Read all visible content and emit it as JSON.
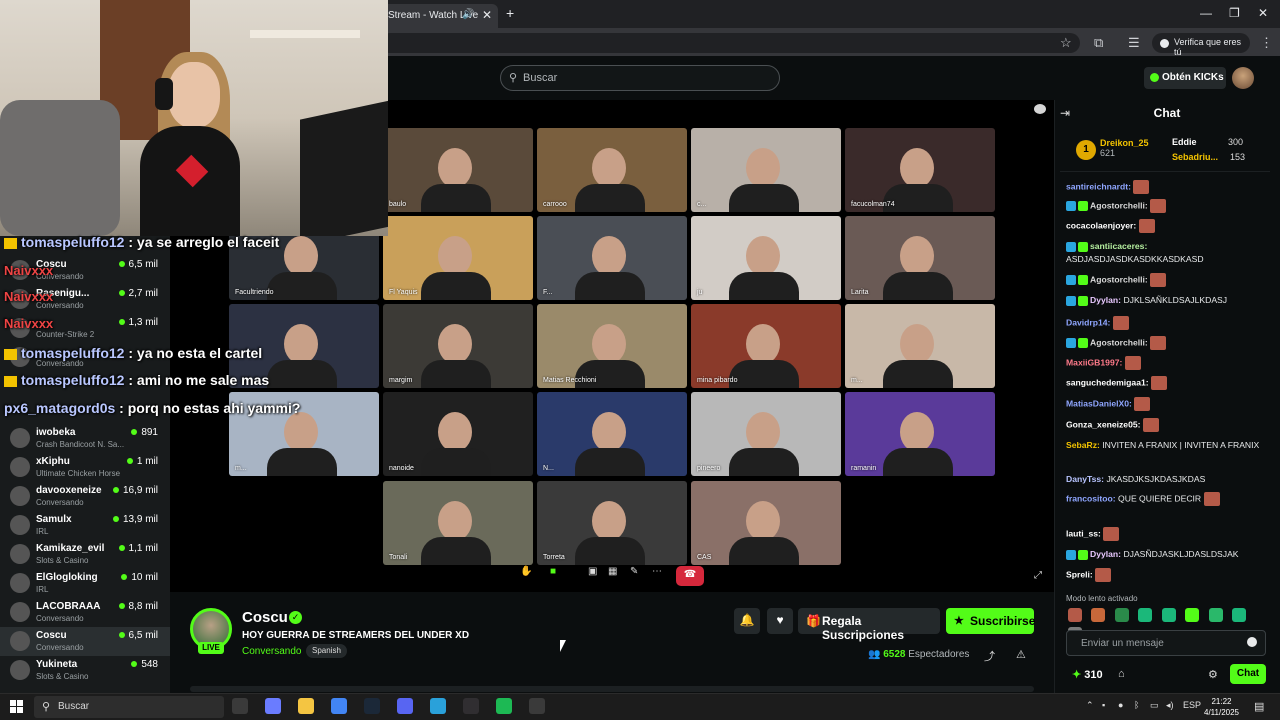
{
  "browser": {
    "tab_title": "Stream - Watch Live",
    "verify_label": "Verifica que eres tú"
  },
  "header": {
    "search_placeholder": "Buscar",
    "kicks_label": "Obtén KICKs"
  },
  "overlay_chat": [
    {
      "user": "tomaspeluffo12",
      "text": ": ya se arreglo el faceit"
    },
    {
      "user": "tomaspeluffo12",
      "text": ": ya no esta el cartel"
    },
    {
      "user": "tomaspeluffo12",
      "text": ": ami no me sale mas"
    },
    {
      "user": "px6_matagord0s",
      "text": ": porq no estas ahi yammi?"
    }
  ],
  "overlay_muted": [
    "Naivxxx",
    "Naivxxx",
    "Naivxxx"
  ],
  "sidebar": {
    "items": [
      {
        "name": "Coscu",
        "category": "Conversando",
        "viewers": "6,5 mil"
      },
      {
        "name": "Rasenigu...",
        "category": "Conversando",
        "viewers": "2,7 mil"
      },
      {
        "name": "",
        "category": "Counter-Strike 2",
        "viewers": "1,3 mil"
      },
      {
        "name": "",
        "category": "Conversando",
        "viewers": ""
      },
      {
        "name": "iwobeka",
        "category": "Crash Bandicoot N. Sa...",
        "viewers": "891"
      },
      {
        "name": "xKiphu",
        "category": "Ultimate Chicken Horse",
        "viewers": "1 mil"
      },
      {
        "name": "davooxeneize",
        "category": "Conversando",
        "viewers": "16,9 mil"
      },
      {
        "name": "Samulx",
        "category": "IRL",
        "viewers": "13,9 mil"
      },
      {
        "name": "Kamikaze_evil",
        "category": "Slots & Casino",
        "viewers": "1,1 mil"
      },
      {
        "name": "ElGlogloking",
        "category": "IRL",
        "viewers": "10 mil"
      },
      {
        "name": "LACOBRAAA",
        "category": "Conversando",
        "viewers": "8,8 mil"
      },
      {
        "name": "Coscu",
        "category": "Conversando",
        "viewers": "6,5 mil"
      },
      {
        "name": "Yukineta",
        "category": "Slots & Casino",
        "viewers": "548"
      }
    ]
  },
  "video": {
    "tiles": [
      {
        "label": "baulo",
        "bg": "#5a4a3a"
      },
      {
        "label": "carrooo",
        "bg": "#7a5f3e"
      },
      {
        "label": "c...",
        "bg": "#b8b0a8"
      },
      {
        "label": "facucolman74",
        "bg": "#3a2a2a"
      },
      {
        "label": "Facultriendo",
        "bg": "#2a2e34"
      },
      {
        "label": "Fl Yaquis",
        "bg": "#c9a05a"
      },
      {
        "label": "F...",
        "bg": "#4a4e55"
      },
      {
        "label": "ju",
        "bg": "#d2ccc6"
      },
      {
        "label": "Larita",
        "bg": "#6a5a55"
      },
      {
        "label": "",
        "bg": "#2c3142"
      },
      {
        "label": "margim",
        "bg": "#3c3a36"
      },
      {
        "label": "Matias Recchioni",
        "bg": "#9a8a6a"
      },
      {
        "label": "mina pibardo",
        "bg": "#8a3a2a"
      },
      {
        "label": "m...",
        "bg": "#c8b8a8"
      },
      {
        "label": "m...",
        "bg": "#a8b4c4"
      },
      {
        "label": "nanoide",
        "bg": "#202020"
      },
      {
        "label": "N...",
        "bg": "#2a3a6a"
      },
      {
        "label": "pineero",
        "bg": "#b8b8b8"
      },
      {
        "label": "ramanin",
        "bg": "#5a3a9a"
      },
      {
        "label": "Tonali",
        "bg": "#6a6a5a"
      },
      {
        "label": "Torreta",
        "bg": "#3a3a3a"
      },
      {
        "label": "CAS",
        "bg": "#8a7068"
      }
    ]
  },
  "channel": {
    "name": "Coscu",
    "live_badge": "LIVE",
    "title": "HOY GUERRA DE STREAMERS DEL UNDER XD",
    "category": "Conversando",
    "language": "Spanish",
    "gift_label": "Regala Suscripciones",
    "subscribe_label": "Suscribirse",
    "viewers_count": "6528",
    "viewers_label": "Espectadores"
  },
  "chat": {
    "title": "Chat",
    "leaders": [
      {
        "rank": "1",
        "name": "Dreikon_25",
        "count": "621"
      },
      {
        "name": "Eddie",
        "count": "300"
      },
      {
        "name": "Sebadriu...",
        "count": "153"
      }
    ],
    "messages": [
      {
        "user": "santireichnardt:",
        "text": "",
        "color": "#8fa6ff",
        "emote": true
      },
      {
        "user": "Agostorchelli:",
        "text": "",
        "color": "#d9d9d9",
        "emote": true
      },
      {
        "user": "cocacolaenjoyer:",
        "text": "",
        "color": "#ffffff",
        "emote": true
      },
      {
        "user": "santiicaceres:",
        "text": "ASDJASDJASDKASDKKASDKASD",
        "color": "#b6f0a0",
        "emote": false
      },
      {
        "user": "Agostorchelli:",
        "text": "",
        "color": "#d9d9d9",
        "emote": true
      },
      {
        "user": "Dyylan:",
        "text": "DJKLSAÑKLDSAJLKDASJ",
        "color": "#e8c8ff",
        "emote": false
      },
      {
        "user": "Davidrp14:",
        "text": "",
        "color": "#8fa6ff",
        "emote": true
      },
      {
        "user": "Agostorchelli:",
        "text": "",
        "color": "#d9d9d9",
        "emote": true
      },
      {
        "user": "MaxiiGB1997:",
        "text": "",
        "color": "#ff7a8a",
        "emote": true
      },
      {
        "user": "sanguchedemigaa1:",
        "text": "",
        "color": "#ffffff",
        "emote": true
      },
      {
        "user": "MatiasDanielX0:",
        "text": "",
        "color": "#8fa6ff",
        "emote": true
      },
      {
        "user": "Gonza_xeneize05:",
        "text": "",
        "color": "#ffffff",
        "emote": true
      },
      {
        "user": "SebaRz:",
        "text": "INVITEN A FRANIX | INVITEN A FRANIX",
        "color": "#f3c300",
        "emote": false
      },
      {
        "user": "DanyTss:",
        "text": "JKASDJKSJKDASJKDAS",
        "color": "#b8c4ff",
        "emote": false
      },
      {
        "user": "francositoo:",
        "text": "QUE QUIERE DECIR",
        "color": "#8fa6ff",
        "emote": true
      },
      {
        "user": "lauti_ss:",
        "text": "",
        "color": "#ffffff",
        "emote": true
      },
      {
        "user": "Dyylan:",
        "text": "DJASÑDJASKLJDASLDSJAK",
        "color": "#e8c8ff",
        "emote": false
      },
      {
        "user": "Spreli:",
        "text": "",
        "color": "#ffffff",
        "emote": true
      }
    ],
    "slow_mode": "Modo lento activado",
    "input_placeholder": "Enviar un mensaje",
    "points": "310",
    "send_label": "Chat"
  },
  "taskbar": {
    "search_label": "Buscar",
    "lang": "ESP",
    "time": "21:22",
    "date": "4/11/2025",
    "apps": [
      {
        "name": "task-view",
        "color": "#3a3a3a"
      },
      {
        "name": "copilot",
        "color": "#6a7cff"
      },
      {
        "name": "file-explorer",
        "color": "#f4c542"
      },
      {
        "name": "chrome",
        "color": "#4285f4"
      },
      {
        "name": "steam",
        "color": "#1b2838"
      },
      {
        "name": "discord",
        "color": "#5865f2"
      },
      {
        "name": "telegram",
        "color": "#2aa1da"
      },
      {
        "name": "obs",
        "color": "#302e31"
      },
      {
        "name": "spotify",
        "color": "#1db954"
      },
      {
        "name": "kick",
        "color": "#3a3a3a"
      }
    ]
  },
  "colors": {
    "accent": "#53fc18",
    "background": "#0b0e0f"
  }
}
